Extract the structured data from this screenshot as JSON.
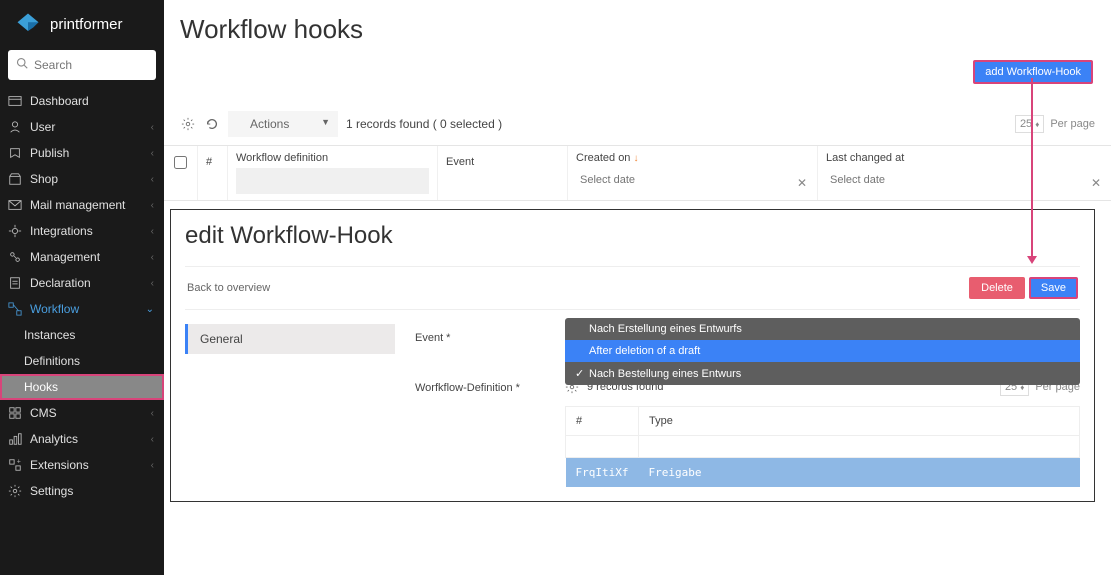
{
  "brand": {
    "name": "printformer"
  },
  "search": {
    "placeholder": "Search"
  },
  "sidebar": {
    "items": [
      {
        "label": "Dashboard"
      },
      {
        "label": "User"
      },
      {
        "label": "Publish"
      },
      {
        "label": "Shop"
      },
      {
        "label": "Mail management"
      },
      {
        "label": "Integrations"
      },
      {
        "label": "Management"
      },
      {
        "label": "Declaration"
      },
      {
        "label": "Workflow"
      },
      {
        "label": "CMS"
      },
      {
        "label": "Analytics"
      },
      {
        "label": "Extensions"
      },
      {
        "label": "Settings"
      }
    ],
    "workflow_sub": [
      {
        "label": "Instances"
      },
      {
        "label": "Definitions"
      },
      {
        "label": "Hooks"
      }
    ]
  },
  "page": {
    "title": "Workflow hooks"
  },
  "buttons": {
    "add": "add Workflow-Hook"
  },
  "toolbar": {
    "actions_label": "Actions",
    "records": "1 records found ( 0 selected )",
    "per_page_label": "Per page",
    "per_page_value": "25"
  },
  "table": {
    "hash": "#",
    "workflow_definition": "Workflow definition",
    "event": "Event",
    "created_on": "Created on",
    "last_changed": "Last changed at",
    "select_date": "Select date"
  },
  "edit": {
    "title": "edit Workflow-Hook",
    "back": "Back to overview",
    "delete": "Delete",
    "save": "Save",
    "tab_general": "General",
    "event_label": "Event *",
    "workflow_def_label": "Worfkflow-Definition *",
    "event_options": [
      {
        "label": "Nach Erstellung eines Entwurfs",
        "checked": false
      },
      {
        "label": "After deletion of a draft",
        "checked": false,
        "highlighted": true
      },
      {
        "label": "Nach Bestellung eines Entwurs",
        "checked": true
      }
    ],
    "def_records": "9 records found",
    "def_per_page": "25",
    "def_per_page_label": "Per page",
    "def_table": {
      "hash": "#",
      "type": "Type",
      "row_hash": "FrqItiXf",
      "row_type": "Freigabe"
    }
  }
}
